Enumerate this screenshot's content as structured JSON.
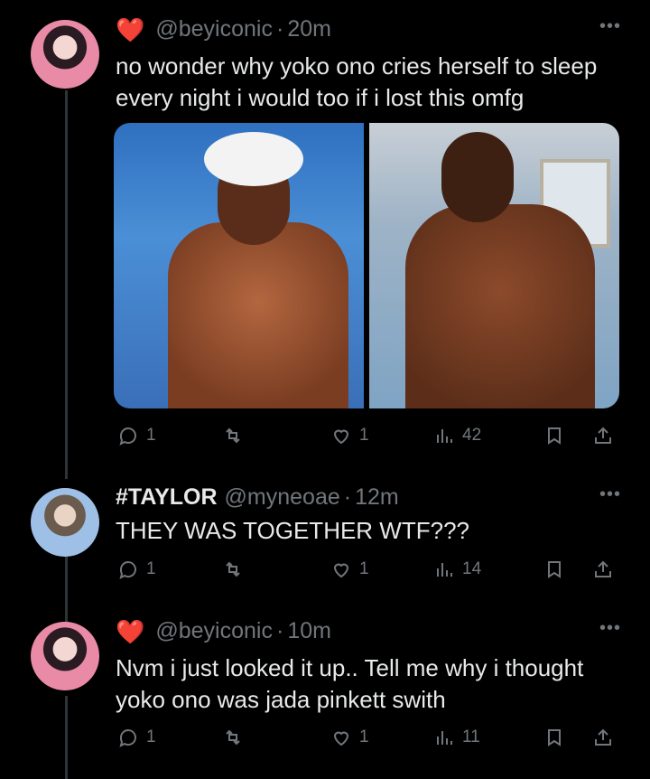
{
  "tweets": [
    {
      "emoji": "❤️",
      "handle": "@beyiconic",
      "time": "20m",
      "text": "no wonder why yoko ono cries herself to sleep every night i would too if i lost this omfg",
      "stats": {
        "replies": "1",
        "retweets": "",
        "likes": "1",
        "views": "42"
      }
    },
    {
      "display_name": "#TAYLOR",
      "handle": "@myneoae",
      "time": "12m",
      "text": "THEY WAS TOGETHER WTF???",
      "stats": {
        "replies": "1",
        "retweets": "",
        "likes": "1",
        "views": "14"
      }
    },
    {
      "emoji": "❤️",
      "handle": "@beyiconic",
      "time": "10m",
      "text": "Nvm i just looked it up.. Tell me why i thought yoko ono was jada pinkett swith",
      "stats": {
        "replies": "1",
        "retweets": "",
        "likes": "1",
        "views": "11"
      }
    }
  ],
  "icons": {
    "reply": "reply-icon",
    "retweet": "retweet-icon",
    "like": "like-icon",
    "views": "views-icon",
    "bookmark": "bookmark-icon",
    "share": "share-icon",
    "more": "more-icon"
  },
  "colors": {
    "background": "#000000",
    "text": "#e7e9ea",
    "muted": "#71767b",
    "heart": "#f91880"
  }
}
